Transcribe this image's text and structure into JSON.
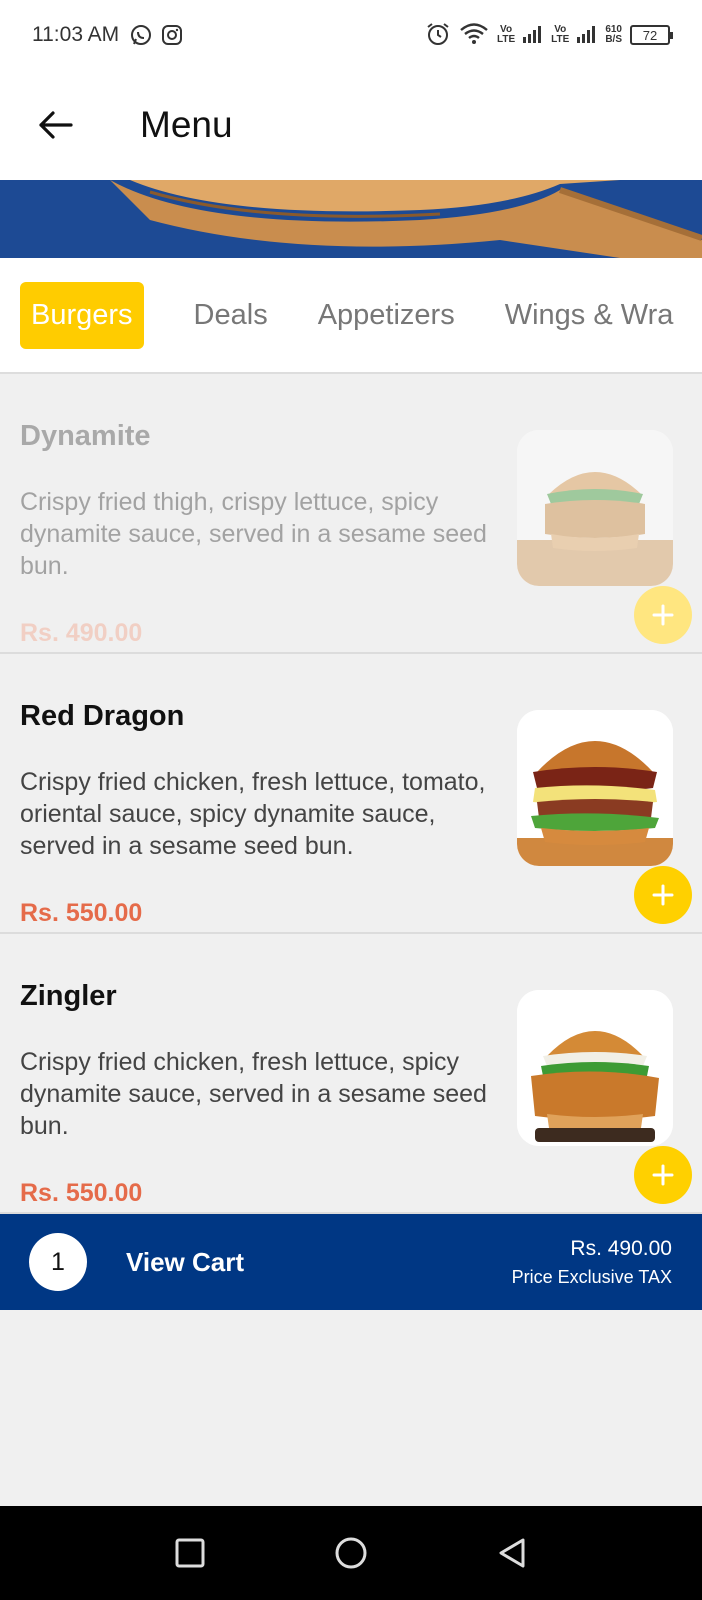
{
  "status_bar": {
    "time": "11:03 AM",
    "sig1_top": "Vo",
    "sig1_bottom": "LTE",
    "sig2_top": "Vo",
    "sig2_bottom": "LTE",
    "speed_top": "610",
    "speed_bottom": "B/S",
    "battery": "72"
  },
  "header": {
    "title": "Menu"
  },
  "tabs": [
    {
      "label": "Burgers",
      "active": true
    },
    {
      "label": "Deals"
    },
    {
      "label": "Appetizers"
    },
    {
      "label": "Wings & Wra"
    }
  ],
  "items": [
    {
      "name": "Dynamite",
      "description": "Crispy fried thigh, crispy lettuce, spicy dynamite sauce, served in a sesame seed bun.",
      "price": "Rs. 490.00"
    },
    {
      "name": "Red Dragon",
      "description": "Crispy fried chicken, fresh lettuce, tomato, oriental sauce, spicy dynamite sauce, served in a sesame seed bun.",
      "price": "Rs. 550.00"
    },
    {
      "name": "Zingler",
      "description": "Crispy fried chicken, fresh lettuce, spicy dynamite sauce, served in a sesame seed bun.",
      "price": "Rs. 550.00"
    }
  ],
  "cart": {
    "count": "1",
    "label": "View Cart",
    "total": "Rs. 490.00",
    "tax_note": "Price Exclusive TAX"
  },
  "colors": {
    "accent": "#ffcc00",
    "price": "#e56b4a",
    "cart_bar": "#003784"
  }
}
